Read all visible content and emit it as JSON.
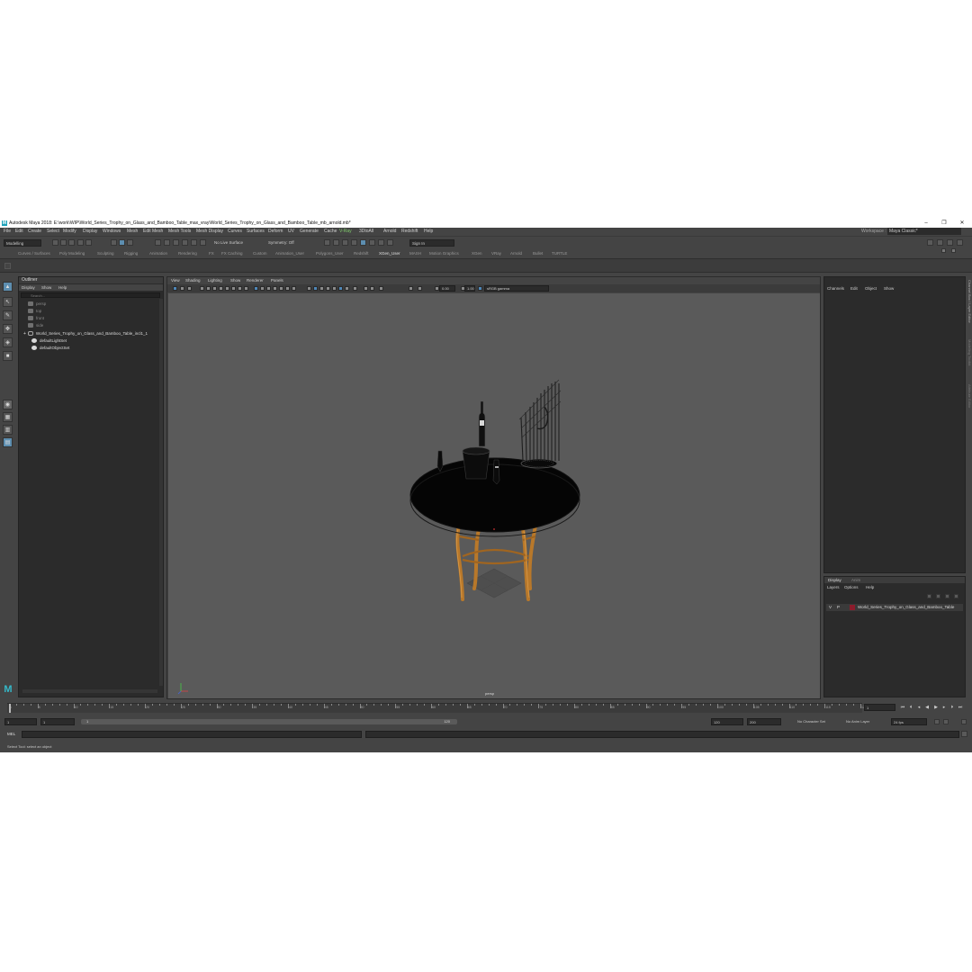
{
  "window": {
    "title": "Autodesk Maya 2018: E:\\work\\WIP\\World_Series_Trophy_on_Glass_and_Bamboo_Table_max_vray\\World_Series_Trophy_on_Glass_and_Bamboo_Table_mb_arnold.mb*",
    "minimize": "–",
    "maximize": "❐",
    "close": "✕"
  },
  "menubar": {
    "items": [
      "File",
      "Edit",
      "Create",
      "Select",
      "Modify",
      "Display",
      "Windows",
      "Mesh",
      "Edit Mesh",
      "Mesh Tools",
      "Mesh Display",
      "Curves",
      "Surfaces",
      "Deform",
      "UV",
      "Generate",
      "Cache",
      "V-Ray",
      "3DtoAll",
      "Arnold",
      "Redshift",
      "Help"
    ],
    "workspace_label": "Workspace :",
    "workspace_value": "Maya Classic*"
  },
  "statusline": {
    "mode": "Modelling",
    "live_surface": "No Live Surface",
    "symmetry": "Symmetry: Off",
    "sign_in": "Sign In"
  },
  "shelf_tabs": [
    "Curves / Surfaces",
    "Poly Modeling",
    "Sculpting",
    "Rigging",
    "Animation",
    "Rendering",
    "FX",
    "FX Caching",
    "Custom",
    "Animation_User",
    "Polygons_User",
    "Redshift",
    "XGen_User",
    "MASH",
    "Motion Graphics",
    "XGen",
    "VRay",
    "Arnold",
    "Bullet",
    "TURTLE"
  ],
  "active_shelf_tab": "XGen_User",
  "outliner": {
    "title": "Outliner",
    "menu": [
      "Display",
      "Show",
      "Help"
    ],
    "search_placeholder": "Search...",
    "items": [
      {
        "label": "persp",
        "kind": "camera"
      },
      {
        "label": "top",
        "kind": "camera"
      },
      {
        "label": "front",
        "kind": "camera"
      },
      {
        "label": "side",
        "kind": "camera"
      },
      {
        "label": "World_Series_Trophy_on_Glass_and_Bamboo_Table_incl1_1",
        "kind": "group"
      },
      {
        "label": "defaultLightSet",
        "kind": "set"
      },
      {
        "label": "defaultObjectSet",
        "kind": "set"
      }
    ]
  },
  "viewport": {
    "menu": [
      "View",
      "Shading",
      "Lighting",
      "Show",
      "Renderer",
      "Panels"
    ],
    "field_a": "0.00",
    "field_b": "1.00",
    "color_space": "sRGB gamma",
    "camera_label": "persp"
  },
  "channel_box": {
    "menu": [
      "Channels",
      "Edit",
      "Object",
      "Show"
    ]
  },
  "layer_editor": {
    "tabs": [
      "Display",
      "Anim"
    ],
    "menu": [
      "Layers",
      "Options",
      "Help"
    ],
    "layer": {
      "v": "V",
      "p": "P",
      "name": "World_Series_Trophy_on_Glass_and_Bamboo_Table",
      "color": "#8c1c2c"
    }
  },
  "side_tabs": [
    "Channel Box / Layer Editor",
    "Modelling Toolkit",
    "Attribute Editor"
  ],
  "timeline": {
    "ticks": [
      "1",
      "5",
      "10",
      "15",
      "20",
      "25",
      "30",
      "35",
      "40",
      "45",
      "50",
      "55",
      "60",
      "65",
      "70",
      "75",
      "80",
      "85",
      "90",
      "95",
      "100",
      "105",
      "110",
      "115",
      "120"
    ],
    "current_frame": "1"
  },
  "range": {
    "start": "1",
    "inner_start": "1",
    "slider_start": "1",
    "slider_end": "120",
    "end": "120",
    "max": "200",
    "character_set": "No Character Set",
    "anim_layer": "No Anim Layer",
    "fps": "24 fps"
  },
  "command": {
    "label": "MEL"
  },
  "help_line": "Select Tool: select an object"
}
